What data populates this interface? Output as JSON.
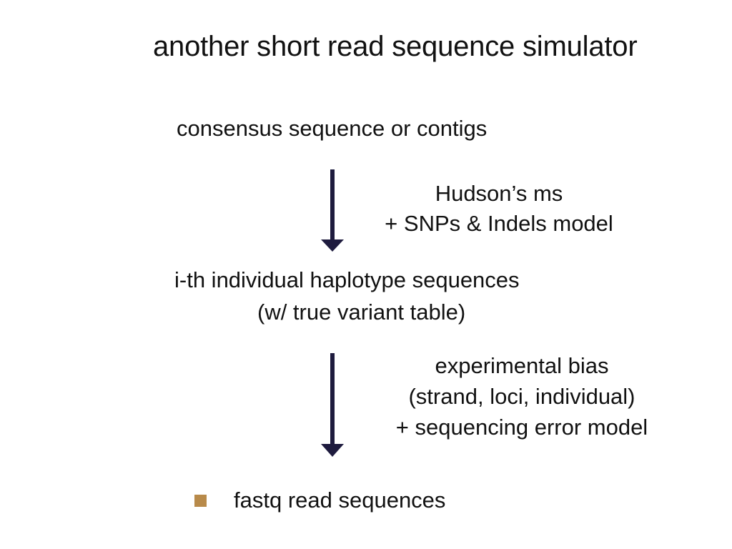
{
  "title": "another short read sequence simulator",
  "steps": {
    "consensus": "consensus sequence or contigs",
    "haplotype_line1": "i-th individual haplotype sequences",
    "haplotype_line2": "(w/ true variant table)"
  },
  "transitions": [
    {
      "lines": [
        "Hudson’s ms",
        "+ SNPs & Indels model"
      ]
    },
    {
      "lines": [
        "experimental bias",
        "(strand, loci, individual)",
        "+ sequencing error model"
      ]
    }
  ],
  "output": {
    "bullet_label": "fastq read sequences"
  },
  "colors": {
    "arrow": "#1e1b3e",
    "bullet": "#b88a4a",
    "text": "#111111"
  }
}
